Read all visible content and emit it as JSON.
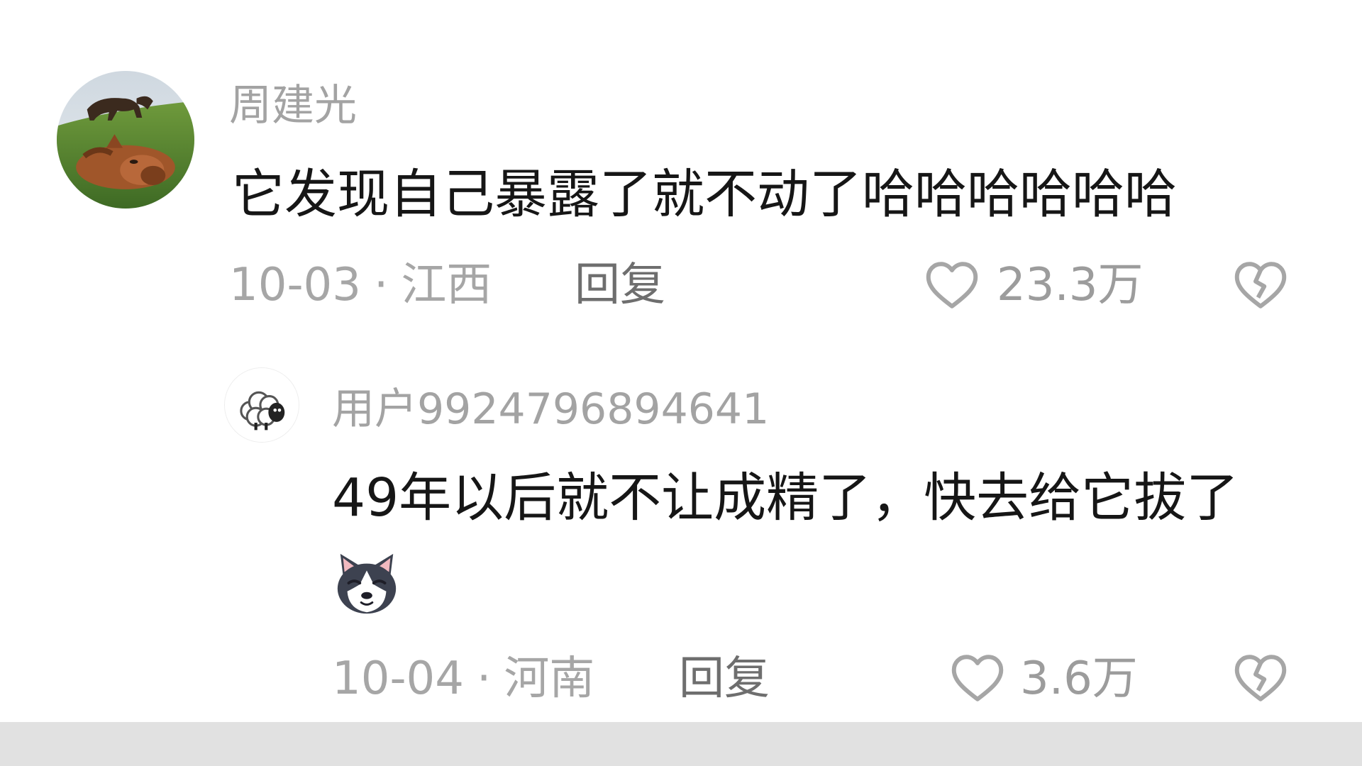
{
  "comments": [
    {
      "username": "周建光",
      "content": "它发现自己暴露了就不动了哈哈哈哈哈哈",
      "date": "10-03",
      "separator": "·",
      "location": "江西",
      "reply_label": "回复",
      "likes": "23.3万",
      "avatar_icon": "horse-photo-avatar"
    },
    {
      "username": "用户9924796894641",
      "content": "49年以后就不让成精了，快去给它拔了",
      "emoji": "husky-dog-emoji",
      "date": "10-04",
      "separator": "·",
      "location": "河南",
      "reply_label": "回复",
      "likes": "3.6万",
      "avatar_icon": "sheep-avatar"
    }
  ],
  "colors": {
    "background": "#ffffff",
    "text_primary": "#161616",
    "text_secondary": "#a3a3a3",
    "reply_text": "#6e6e6e",
    "bottom_bar": "#e1e1e1"
  }
}
